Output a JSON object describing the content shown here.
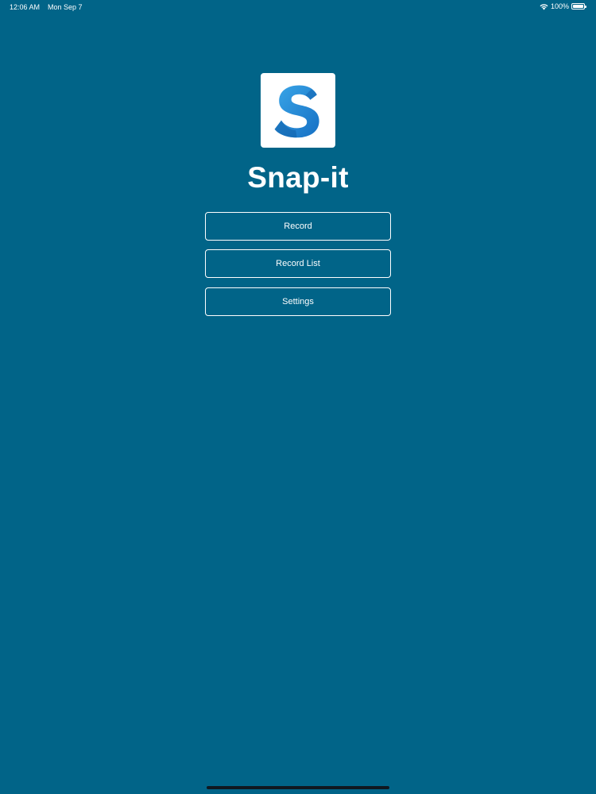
{
  "status_bar": {
    "time": "12:06 AM",
    "date": "Mon Sep 7",
    "battery": "100%",
    "icons": [
      "wifi-icon",
      "battery-icon"
    ]
  },
  "app": {
    "title": "Snap-it",
    "logo_icon": "s-logo-icon",
    "brand_color": "#016488"
  },
  "menu": {
    "record_label": "Record",
    "record_list_label": "Record List",
    "settings_label": "Settings"
  }
}
